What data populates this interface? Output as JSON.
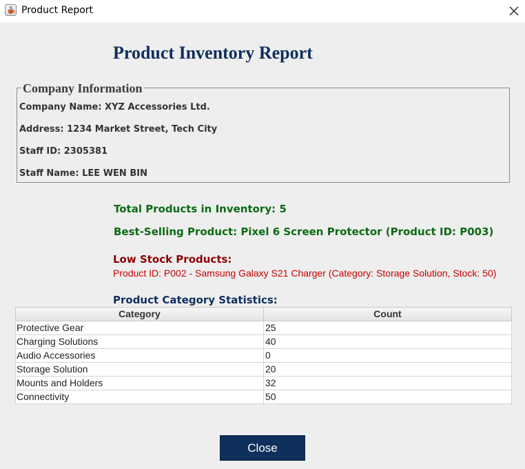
{
  "window": {
    "title": "Product Report",
    "icon": "java-cup-icon",
    "close_icon": "close-icon"
  },
  "report": {
    "title": "Product Inventory Report"
  },
  "company": {
    "legend": "Company Information",
    "name_line": "Company Name: XYZ Accessories Ltd.",
    "address_line": "Address: 1234 Market Street, Tech City",
    "staff_id_line": "Staff ID: 2305381",
    "staff_name_line": "Staff Name: LEE WEN BIN"
  },
  "stats": {
    "total_products": "Total Products in Inventory: 5",
    "best_selling": "Best-Selling Product: Pixel 6 Screen Protector (Product ID: P003)",
    "low_stock_title": "Low Stock Products:",
    "low_stock_item": "Product ID: P002 - Samsung Galaxy S21 Charger (Category: Storage Solution, Stock: 50)",
    "category_title": "Product Category Statistics:"
  },
  "table": {
    "headers": [
      "Category",
      "Count"
    ],
    "rows": [
      [
        "Protective Gear",
        "25"
      ],
      [
        "Charging Solutions",
        "40"
      ],
      [
        "Audio Accessories",
        "0"
      ],
      [
        "Storage Solution",
        "20"
      ],
      [
        "Mounts and Holders",
        "32"
      ],
      [
        "Connectivity",
        "50"
      ]
    ]
  },
  "buttons": {
    "close_label": "Close"
  },
  "colors": {
    "navy": "#0f2f5d",
    "green": "#0b6b12",
    "dark_red": "#8b0000",
    "red": "#c60000",
    "background": "#eeeeee"
  }
}
